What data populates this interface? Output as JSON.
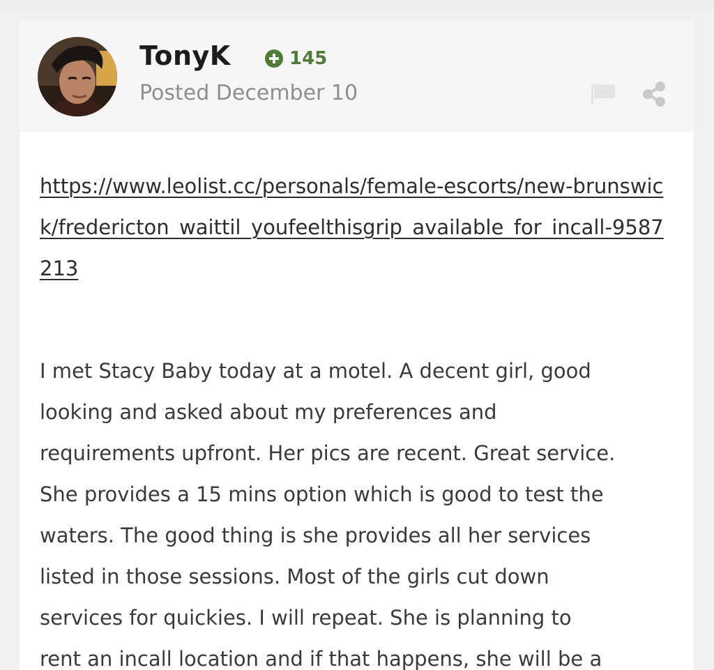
{
  "post": {
    "author": {
      "name": "TonyK",
      "reputation": "145"
    },
    "posted": "Posted December 10",
    "link": {
      "text": "https://www.leolist.cc/personals/female-escorts/new-brunswick/fredericton_waittil_youfeelthisgrip_available_for_incall-9587213"
    },
    "body_lines": [
      "I met Stacy Baby today at a motel. A decent girl, good",
      "looking and asked about my preferences and",
      "requirements upfront. Her pics are recent. Great service.",
      "She provides a 15 mins option which is good to test the",
      "waters. The good thing is she provides all her services",
      "listed in those sessions. Most of the girls cut down",
      "services for quickies. I will repeat. She is planning to",
      "rent an incall location and if that happens, she will be a"
    ]
  },
  "icons": {
    "reputation": "plus-circle-icon",
    "report": "flag-icon",
    "share": "share-icon"
  },
  "colors": {
    "reputation_green": "#4f7a38",
    "date_gray": "#8e8e8e",
    "icon_gray": "#c9c9c9",
    "header_bg": "#f6f6f6",
    "body_bg": "#ffffff"
  }
}
